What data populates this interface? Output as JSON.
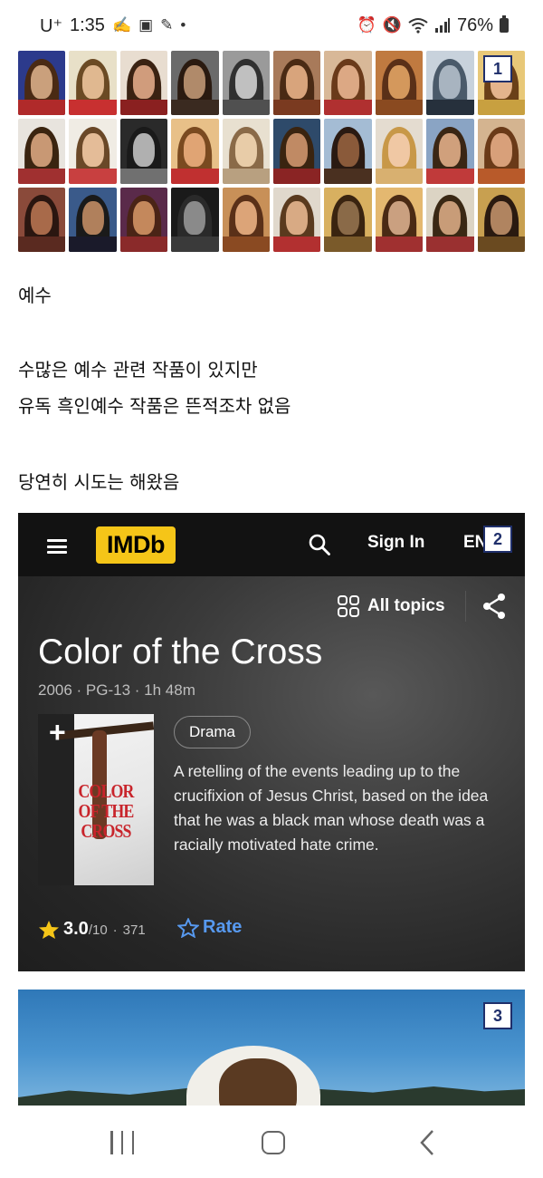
{
  "status_bar": {
    "carrier": "U⁺",
    "time": "1:35",
    "notification_icons": [
      "hand-icon",
      "gallery-icon",
      "pencil-icon",
      "dot-icon"
    ],
    "right_icons": [
      "alarm-icon",
      "mute-icon",
      "wifi-icon",
      "signal-icon"
    ],
    "battery": "76%"
  },
  "collage": {
    "badge": "1",
    "tiles": [
      {
        "bg": "#2c3a8c",
        "hair": "#4a2a14",
        "face": "#caa07c",
        "robe": "#b02a2a"
      },
      {
        "bg": "#e8e0c8",
        "hair": "#6b4a24",
        "face": "#e0b890",
        "robe": "#c83030"
      },
      {
        "bg": "#e8ddd0",
        "hair": "#3a2212",
        "face": "#d09c7c",
        "robe": "#8a2020"
      },
      {
        "bg": "#6a6a6a",
        "hair": "#2a1a10",
        "face": "#b08a6a",
        "robe": "#3a2a20"
      },
      {
        "bg": "#9a9a9a",
        "hair": "#303030",
        "face": "#c0c0c0",
        "robe": "#505050"
      },
      {
        "bg": "#a87a5a",
        "hair": "#4a2a14",
        "face": "#d8a47c",
        "robe": "#7a3a20"
      },
      {
        "bg": "#d8b898",
        "hair": "#6a3a1a",
        "face": "#dca884",
        "robe": "#b03030"
      },
      {
        "bg": "#c07a40",
        "hair": "#5a3018",
        "face": "#d4985c",
        "robe": "#8a4a20"
      },
      {
        "bg": "#c8d2dc",
        "hair": "#4a5a6a",
        "face": "#a8b4c0",
        "robe": "#26303c"
      },
      {
        "bg": "#e8c878",
        "hair": "#6a4018",
        "face": "#e4b48c",
        "robe": "#c8a040"
      },
      {
        "bg": "#e8e4de",
        "hair": "#3a2410",
        "face": "#c89874",
        "robe": "#a03030"
      },
      {
        "bg": "#f0ece4",
        "hair": "#6a4828",
        "face": "#e4bc98",
        "robe": "#c84040"
      },
      {
        "bg": "#2a2a2a",
        "hair": "#1a1a1a",
        "face": "#b0b0b0",
        "robe": "#707070"
      },
      {
        "bg": "#e8c088",
        "hair": "#7a4a20",
        "face": "#e0a474",
        "robe": "#c03030"
      },
      {
        "bg": "#e8e0d0",
        "hair": "#8a6a48",
        "face": "#e8cca8",
        "robe": "#b8a080"
      },
      {
        "bg": "#2e4a6a",
        "hair": "#3a2410",
        "face": "#c08a64",
        "robe": "#8a2424"
      },
      {
        "bg": "#a4bcd4",
        "hair": "#2a1a12",
        "face": "#8a5a3a",
        "robe": "#4a3020"
      },
      {
        "bg": "#e4dcd0",
        "hair": "#c89848",
        "face": "#f0c8a4",
        "robe": "#d8b070"
      },
      {
        "bg": "#8aa4c4",
        "hair": "#3a2614",
        "face": "#d0a07c",
        "robe": "#c03a3a"
      },
      {
        "bg": "#d4b490",
        "hair": "#6a3a18",
        "face": "#d8a07a",
        "robe": "#b85a2a"
      },
      {
        "bg": "#8a4a3a",
        "hair": "#2a1610",
        "face": "#a86a4a",
        "robe": "#5a2a20"
      },
      {
        "bg": "#3a5a8a",
        "hair": "#1a1a1a",
        "face": "#b0805c",
        "robe": "#1a1a2a"
      },
      {
        "bg": "#5a2a4a",
        "hair": "#4a2416",
        "face": "#c4885c",
        "robe": "#8a2a2a"
      },
      {
        "bg": "#1a1a1a",
        "hair": "#2a2a2a",
        "face": "#8a8a8a",
        "robe": "#3a3a3a"
      },
      {
        "bg": "#c89058",
        "hair": "#5a3018",
        "face": "#dca478",
        "robe": "#8a4a22"
      },
      {
        "bg": "#e0d8cc",
        "hair": "#5a3a1e",
        "face": "#d8aa84",
        "robe": "#b23030"
      },
      {
        "bg": "#d8b060",
        "hair": "#3a2410",
        "face": "#8a6a48",
        "robe": "#7a5a2a"
      },
      {
        "bg": "#e4b870",
        "hair": "#4a2a14",
        "face": "#caa080",
        "robe": "#a03030"
      },
      {
        "bg": "#dcd4c4",
        "hair": "#3a2814",
        "face": "#c89c78",
        "robe": "#9a3030"
      },
      {
        "bg": "#c8a050",
        "hair": "#2a1a10",
        "face": "#b08460",
        "robe": "#6a4a20"
      }
    ]
  },
  "post": {
    "line1": "예수",
    "line2": "수많은 예수 관련 작품이 있지만",
    "line3": "유독 흑인예수 작품은 뜬적조차 없음",
    "line4": "당연히 시도는 해왔음"
  },
  "imdb": {
    "badge": "2",
    "logo": "IMDb",
    "sign_in": "Sign In",
    "language": "EN",
    "all_topics": "All topics",
    "title": "Color of the Cross",
    "meta": "2006 · PG-13 · 1h 48m",
    "poster_title": "COLOR OF THE CROSS",
    "genre": "Drama",
    "plot": "A retelling of the events leading up to the crucifixion of Jesus Christ, based on the idea that he was a black man whose death was a racially motivated hate crime.",
    "rating_value": "3.0",
    "rating_scale": "/10",
    "rating_count": "371",
    "rate_label": "Rate",
    "colors": {
      "logo_yellow": "#f5c518",
      "rate_blue": "#5799ef",
      "star": "#f5c518"
    }
  },
  "photo3": {
    "badge": "3"
  }
}
